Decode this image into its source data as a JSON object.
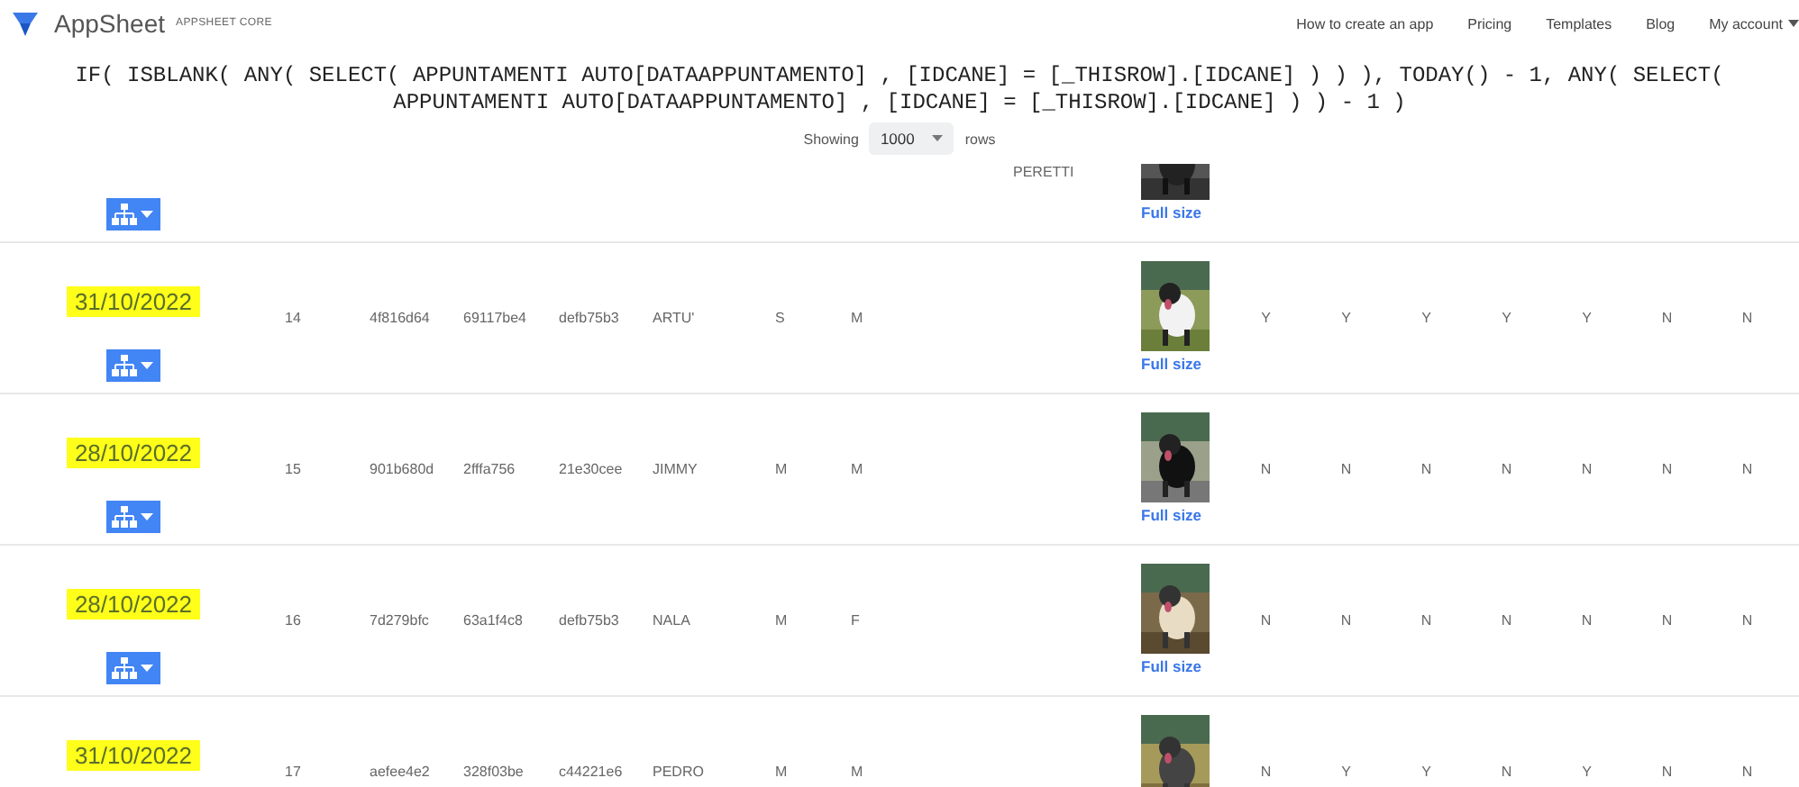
{
  "header": {
    "brand": "AppSheet",
    "edition": "APPSHEET CORE",
    "nav": [
      {
        "label": "How to create an app",
        "dropdown": false
      },
      {
        "label": "Pricing",
        "dropdown": false
      },
      {
        "label": "Templates",
        "dropdown": false
      },
      {
        "label": "Blog",
        "dropdown": false
      },
      {
        "label": "My account",
        "dropdown": true
      }
    ]
  },
  "formula": "IF( ISBLANK( ANY( SELECT( APPUNTAMENTI AUTO[DATAAPPUNTAMENTO] , [IDCANE] = [_THISROW].[IDCANE] ) ) ), TODAY() - 1, ANY( SELECT( APPUNTAMENTI AUTO[DATAAPPUNTAMENTO] , [IDCANE] = [_THISROW].[IDCANE] ) ) - 1 )",
  "paging": {
    "label": "Showing",
    "value": "1000",
    "suffix": "rows"
  },
  "partial_row": {
    "column_8": "PERETTI",
    "photo_link": "Full size"
  },
  "rows": [
    {
      "date": "31/10/2022",
      "highlighted": true,
      "menu_button": true,
      "cells": [
        "14",
        "4f816d64",
        "69117be4",
        "defb75b3",
        "ARTU'",
        "S",
        "M"
      ],
      "photo_link": "Full size",
      "flags": [
        "Y",
        "Y",
        "Y",
        "Y",
        "Y",
        "N",
        "N"
      ]
    },
    {
      "date": "28/10/2022",
      "highlighted": true,
      "menu_button": true,
      "cells": [
        "15",
        "901b680d",
        "2fffa756",
        "21e30cee",
        "JIMMY",
        "M",
        "M"
      ],
      "photo_link": "Full size",
      "flags": [
        "N",
        "N",
        "N",
        "N",
        "N",
        "N",
        "N"
      ]
    },
    {
      "date": "28/10/2022",
      "highlighted": true,
      "menu_button": true,
      "cells": [
        "16",
        "7d279bfc",
        "63a1f4c8",
        "defb75b3",
        "NALA",
        "M",
        "F"
      ],
      "photo_link": "Full size",
      "flags": [
        "N",
        "N",
        "N",
        "N",
        "N",
        "N",
        "N"
      ]
    },
    {
      "date": "31/10/2022",
      "highlighted": true,
      "menu_button": false,
      "cells": [
        "17",
        "aefee4e2",
        "328f03be",
        "c44221e6",
        "PEDRO",
        "M",
        "M"
      ],
      "flags": [
        "N",
        "Y",
        "Y",
        "N",
        "Y",
        "N",
        "N"
      ]
    }
  ]
}
